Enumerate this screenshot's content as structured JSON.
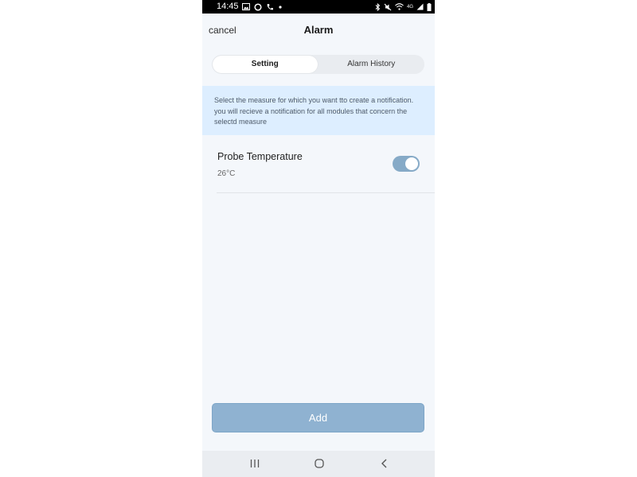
{
  "status_bar": {
    "time": "14:45",
    "left_icons": [
      "image-icon",
      "circle-icon",
      "phone-icon",
      "dot-icon"
    ],
    "right_icons": [
      "bluetooth-icon",
      "mute-icon",
      "wifi-icon",
      "signal-icon",
      "battery-icon"
    ],
    "network_label": "4G"
  },
  "header": {
    "cancel_label": "cancel",
    "title": "Alarm"
  },
  "tabs": [
    {
      "label": "Setting",
      "active": true
    },
    {
      "label": "Alarm History",
      "active": false
    }
  ],
  "info": {
    "text": "Select the measure for which you want tto create a notification. you will recieve a notification for all modules that concern the selectd measure"
  },
  "measure": {
    "name": "Probe Temperature",
    "value": "26°C",
    "enabled": true
  },
  "add_label": "Add",
  "colors": {
    "background": "#f4f7fb",
    "banner": "#ddeeff",
    "toggle_on": "#86aac7",
    "add_button": "#8fb2d1",
    "nav_bar": "#eaedf1"
  },
  "nav": [
    "recent-apps-icon",
    "home-icon",
    "back-icon"
  ]
}
